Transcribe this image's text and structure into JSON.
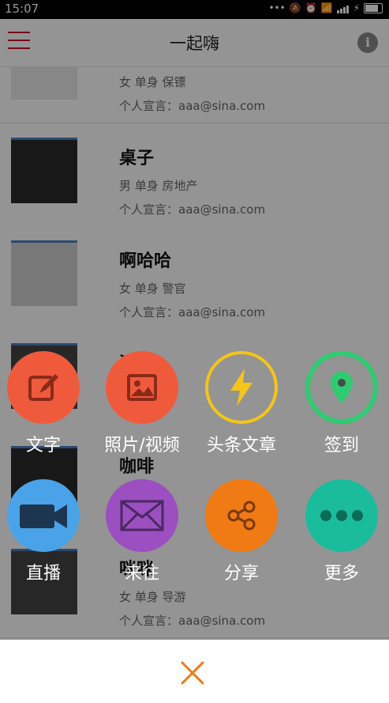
{
  "status_bar": {
    "time": "15:07"
  },
  "navbar": {
    "title": "一起嗨"
  },
  "list": [
    {
      "name": "",
      "meta": "女 单身 保镖",
      "declaration": "个人宣言：aaa@sina.com"
    },
    {
      "name": "桌子",
      "meta": "男 单身 房地产",
      "declaration": "个人宣言：aaa@sina.com"
    },
    {
      "name": "啊哈哈",
      "meta": "女 单身 警官",
      "declaration": "个人宣言：aaa@sina.com"
    },
    {
      "name": "测试",
      "meta": "",
      "declaration": ""
    },
    {
      "name": "咖啡",
      "meta": "",
      "declaration": ""
    },
    {
      "name": "咪咪",
      "meta": "女 单身 导游",
      "declaration": "个人宣言：aaa@sina.com"
    }
  ],
  "actions": [
    {
      "label": "文字",
      "icon": "edit-icon",
      "color": "#f05a3c"
    },
    {
      "label": "照片/视频",
      "icon": "image-icon",
      "color": "#f05a3c"
    },
    {
      "label": "头条文章",
      "icon": "lightning-icon",
      "color": "#f5c518"
    },
    {
      "label": "签到",
      "icon": "location-pin-icon",
      "color": "#2ecc71"
    },
    {
      "label": "直播",
      "icon": "video-camera-icon",
      "color": "#4aa3e8"
    },
    {
      "label": "来往",
      "icon": "mail-icon",
      "color": "#9b4fc0"
    },
    {
      "label": "分享",
      "icon": "share-icon",
      "color": "#f07b14"
    },
    {
      "label": "更多",
      "icon": "more-dots-icon",
      "color": "#1abc9c"
    }
  ],
  "close_color": "#f07b14"
}
